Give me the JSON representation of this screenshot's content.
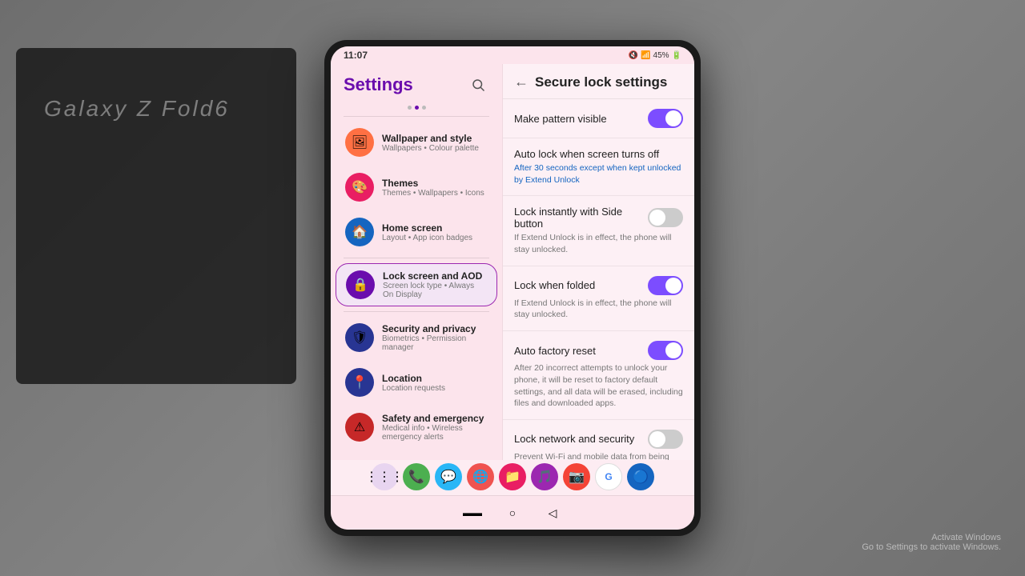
{
  "background": {
    "color": "#787878"
  },
  "status_bar": {
    "time": "11:07",
    "battery": "45%",
    "icons": "🔇 📶 🔋"
  },
  "settings_panel": {
    "title": "Settings",
    "search_label": "Search",
    "items": [
      {
        "id": "wallpaper",
        "title": "Wallpaper and style",
        "subtitle": "Wallpapers • Colour palette",
        "icon": "🖼",
        "icon_color": "orange",
        "active": false
      },
      {
        "id": "themes",
        "title": "Themes",
        "subtitle": "Themes • Wallpapers • Icons",
        "icon": "🎨",
        "icon_color": "red-pink",
        "active": false
      },
      {
        "id": "home-screen",
        "title": "Home screen",
        "subtitle": "Layout • App icon badges",
        "icon": "🏠",
        "icon_color": "blue",
        "active": false
      },
      {
        "id": "lock-screen",
        "title": "Lock screen and AOD",
        "subtitle": "Screen lock type • Always On Display",
        "icon": "🔒",
        "icon_color": "purple",
        "active": true
      },
      {
        "id": "security",
        "title": "Security and privacy",
        "subtitle": "Biometrics • Permission manager",
        "icon": "🛡",
        "icon_color": "indigo",
        "active": false
      },
      {
        "id": "location",
        "title": "Location",
        "subtitle": "Location requests",
        "icon": "📍",
        "icon_color": "indigo",
        "active": false
      },
      {
        "id": "safety",
        "title": "Safety and emergency",
        "subtitle": "Medical info • Wireless emergency alerts",
        "icon": "⚠",
        "icon_color": "red",
        "active": false
      }
    ]
  },
  "lock_settings_panel": {
    "title": "Secure lock settings",
    "back_label": "←",
    "items": [
      {
        "id": "make-pattern-visible",
        "title": "Make pattern visible",
        "subtitle": "",
        "has_toggle": true,
        "toggle_state": "on"
      },
      {
        "id": "auto-lock",
        "title": "Auto lock when screen turns off",
        "subtitle": "After 30 seconds except when kept unlocked by Extend Unlock",
        "subtitle_color": "blue",
        "has_toggle": false
      },
      {
        "id": "lock-instantly",
        "title": "Lock instantly with Side button",
        "subtitle": "If Extend Unlock is in effect, the phone will stay unlocked.",
        "has_toggle": true,
        "toggle_state": "off"
      },
      {
        "id": "lock-when-folded",
        "title": "Lock when folded",
        "subtitle": "If Extend Unlock is in effect, the phone will stay unlocked.",
        "has_toggle": true,
        "toggle_state": "on"
      },
      {
        "id": "auto-factory-reset",
        "title": "Auto factory reset",
        "subtitle": "After 20 incorrect attempts to unlock your phone, it will be reset to factory default settings, and all data will be erased, including files and downloaded apps.",
        "has_toggle": true,
        "toggle_state": "on"
      },
      {
        "id": "lock-network",
        "title": "Lock network and security",
        "subtitle": "Prevent Wi-Fi and mobile data from being turned off when your phone is locked. Find My Mobile uses these connections to locate and control your phone when it's lost.",
        "has_toggle": true,
        "toggle_state": "off"
      }
    ]
  },
  "nav_bar": {
    "items": [
      "⋮⋮⋮",
      "○",
      "◁"
    ]
  },
  "app_dock": {
    "apps": [
      "📞",
      "💬",
      "🌐",
      "📁",
      "🎵",
      "📷",
      "G",
      "🌀",
      "🔵"
    ]
  },
  "activate_windows": {
    "line1": "Activate Windows",
    "line2": "Go to Settings to activate Windows."
  },
  "samsung_text": "Galaxy Z Fold6"
}
